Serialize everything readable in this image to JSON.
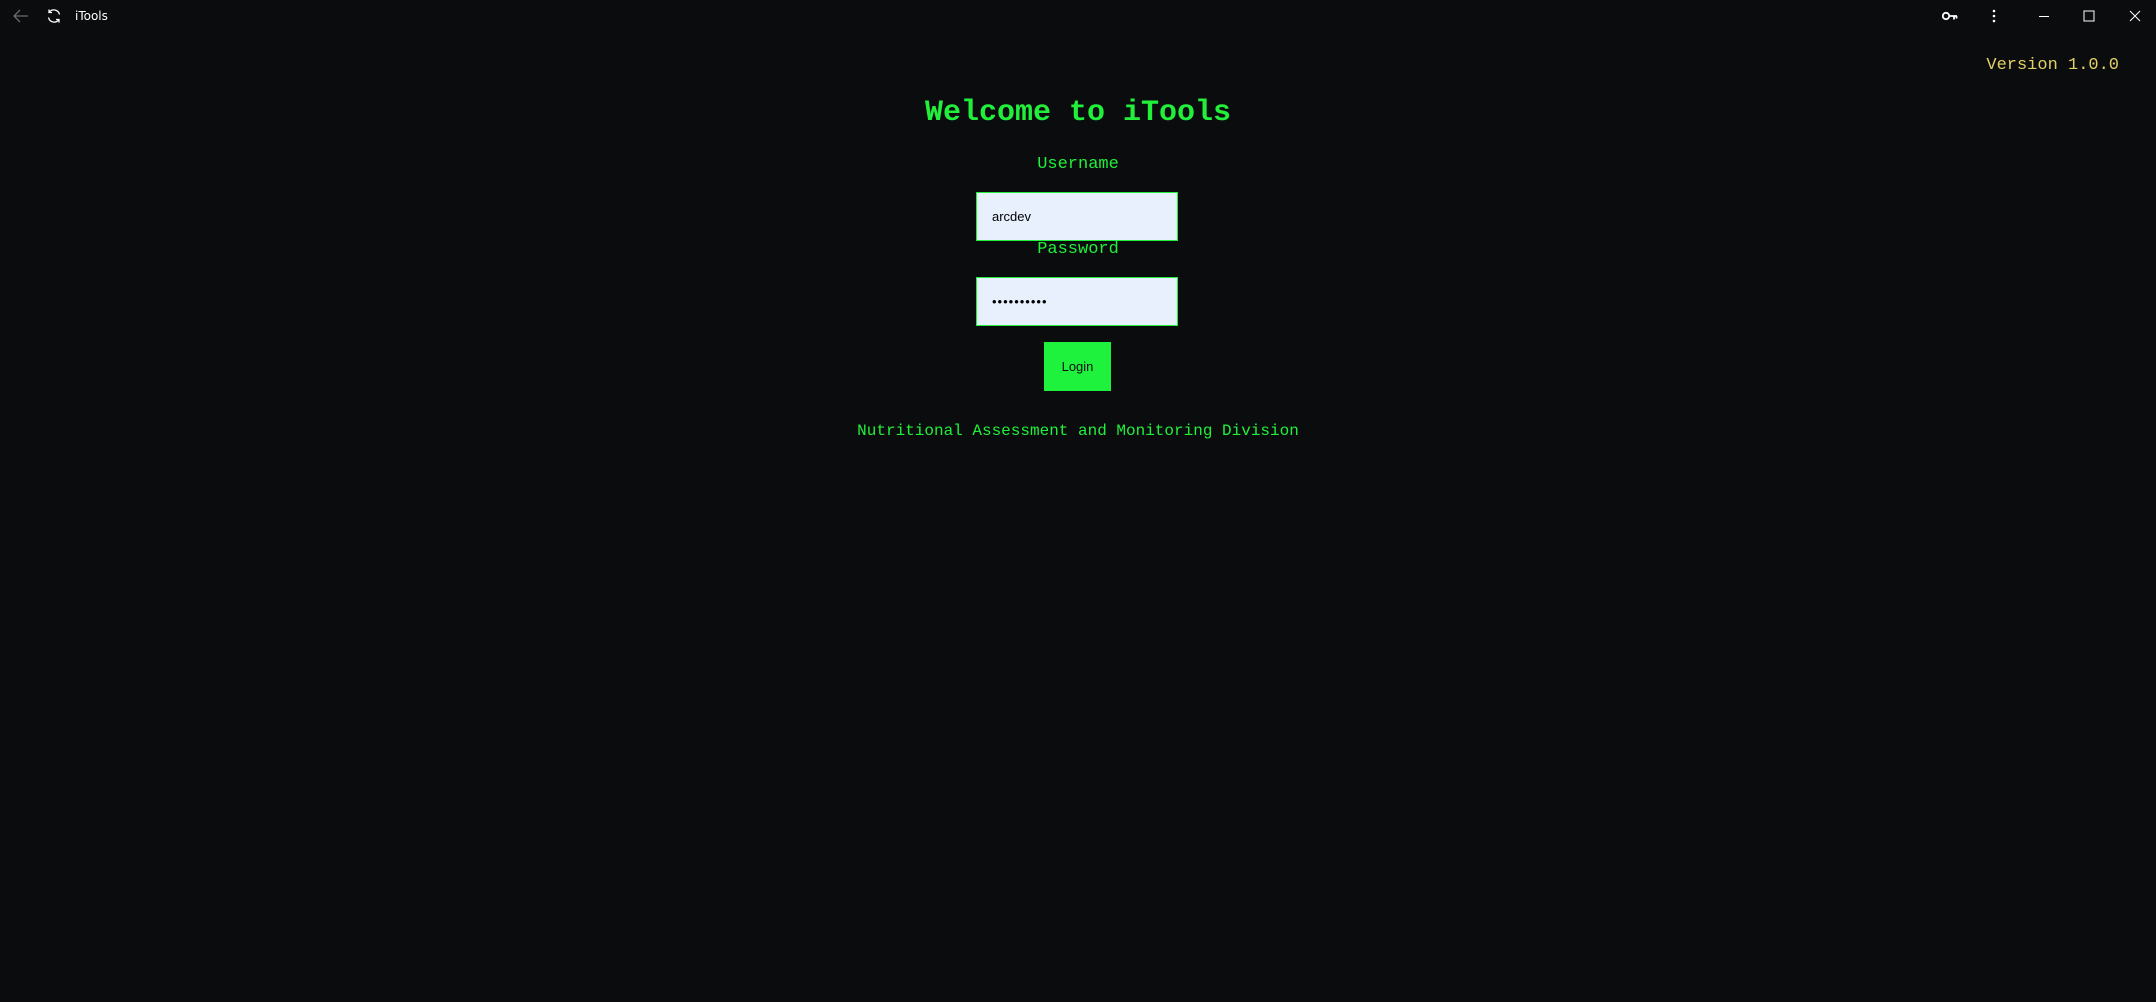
{
  "window": {
    "title": "iTools",
    "icons": {
      "back": "arrow-left-icon",
      "refresh": "refresh-icon",
      "key": "key-icon",
      "more": "more-vertical-icon",
      "minimize": "minimize-icon",
      "maximize": "maximize-icon",
      "close": "close-icon"
    }
  },
  "version": "Version 1.0.0",
  "login": {
    "heading": "Welcome to iTools",
    "username_label": "Username",
    "username_value": "arcdev",
    "password_label": "Password",
    "password_value": "••••••••••",
    "login_button": "Login"
  },
  "footer": {
    "division": "Nutritional Assessment and Monitoring Division"
  },
  "colors": {
    "background": "#0a0c0e",
    "accent_green": "#22ef3a",
    "version_yellow": "#e3cf66",
    "input_background": "#e8f0fe"
  }
}
